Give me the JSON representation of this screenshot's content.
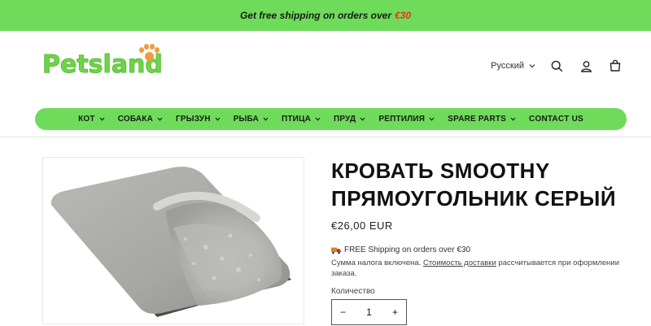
{
  "announcement": {
    "text": "Get free shipping on orders over",
    "amount": "€30"
  },
  "header": {
    "logo_text": "Petsland",
    "language": "Русский",
    "icons": [
      "search-icon",
      "account-icon",
      "cart-icon"
    ]
  },
  "nav": {
    "items": [
      {
        "label": "КОТ",
        "dropdown": true
      },
      {
        "label": "СОБАКА",
        "dropdown": true
      },
      {
        "label": "ГРЫЗУН",
        "dropdown": true
      },
      {
        "label": "РЫБА",
        "dropdown": true
      },
      {
        "label": "ПТИЦА",
        "dropdown": true
      },
      {
        "label": "ПРУД",
        "dropdown": true
      },
      {
        "label": "РЕПТИЛИЯ",
        "dropdown": true
      },
      {
        "label": "SPARE PARTS",
        "dropdown": true
      },
      {
        "label": "CONTACT US",
        "dropdown": false
      }
    ]
  },
  "product": {
    "title_line1": "КРОВАТЬ SMOOTHY",
    "title_line2": "ПРЯМОУГОЛЬНИК СЕРЫЙ",
    "price": "€26,00 EUR",
    "shipping_text": "FREE Shipping on orders over €30",
    "tax_before": "Сумма налога включена.",
    "tax_link": "Стоимость доставки",
    "tax_after": "рассчитывается при оформлении заказа.",
    "quantity_label": "Количество",
    "quantity_value": "1",
    "minus": "−",
    "plus": "+"
  },
  "colors": {
    "brand_green": "#6fdb5a",
    "accent_red": "#e8341d",
    "paw_orange": "#f39a3a"
  }
}
